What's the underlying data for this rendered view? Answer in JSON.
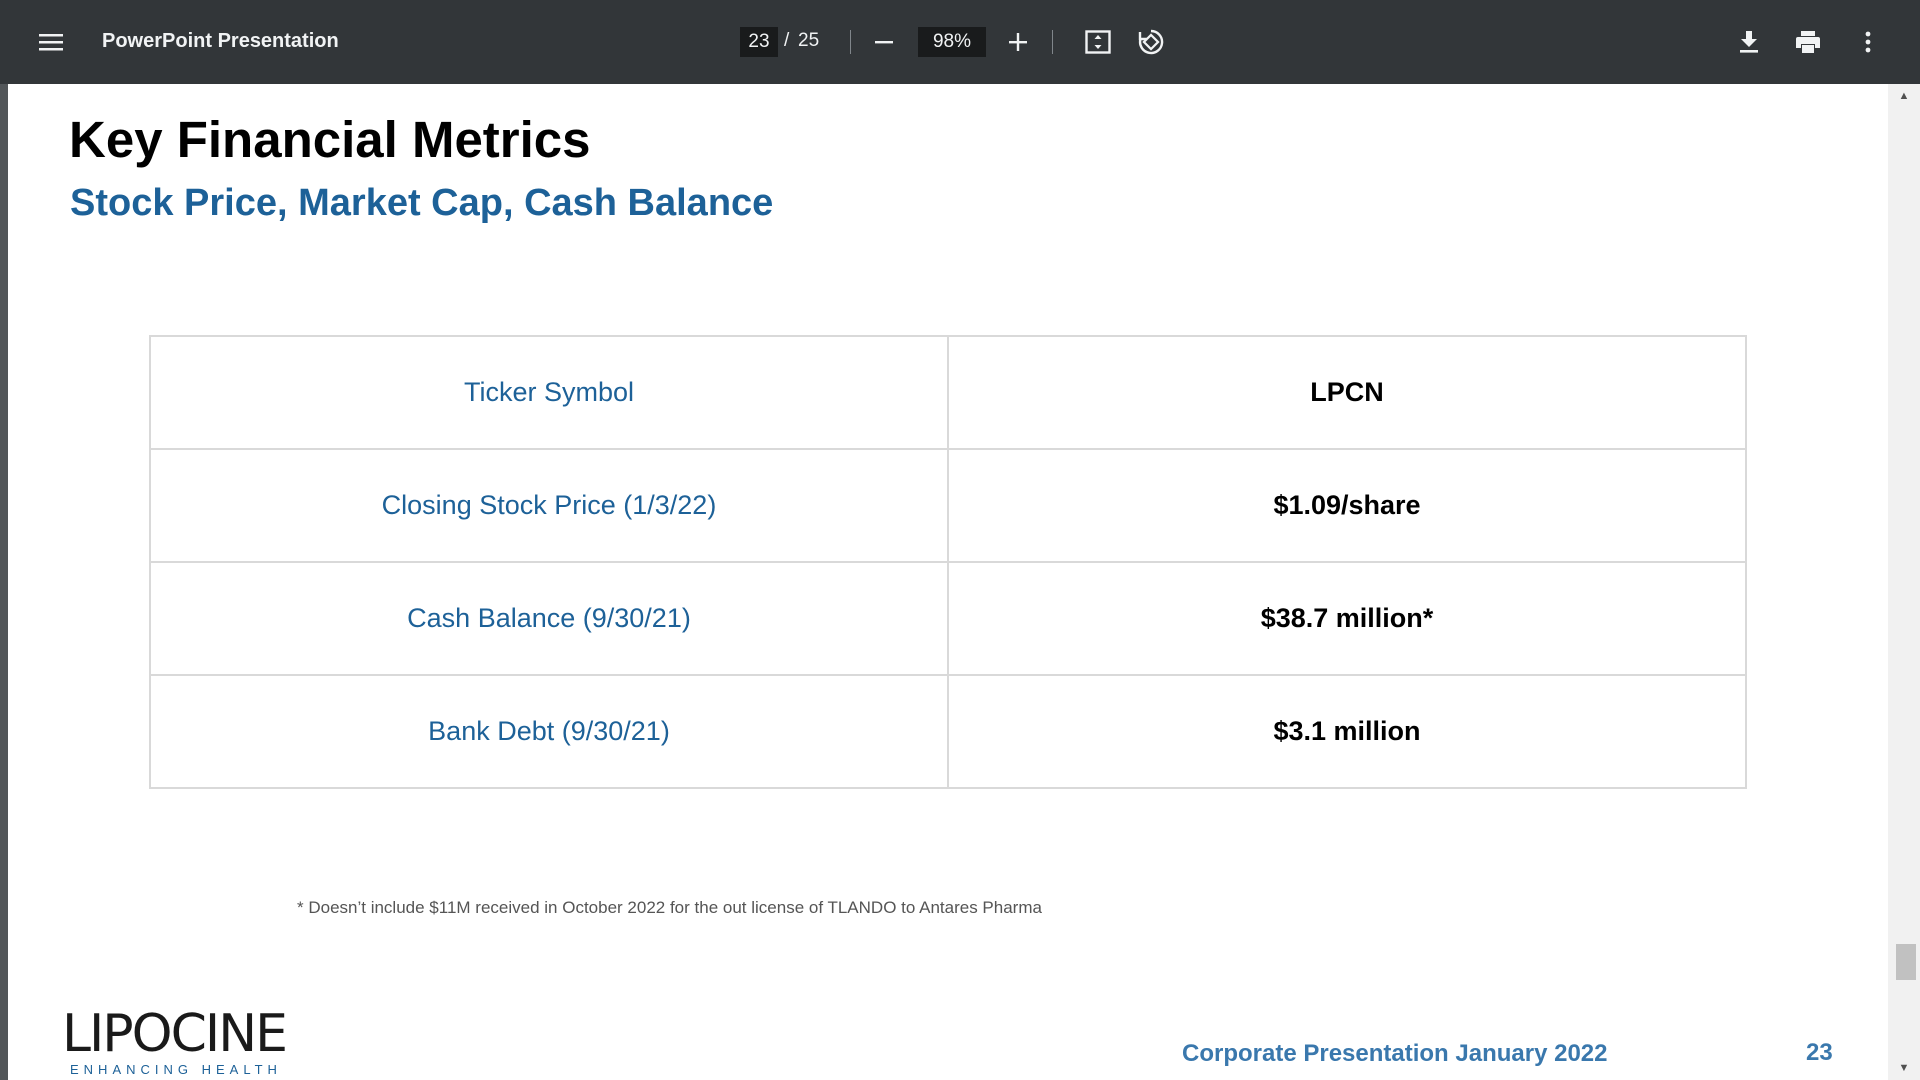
{
  "toolbar": {
    "title": "PowerPoint Presentation",
    "current_page": "23",
    "page_separator": "/",
    "total_pages": "25",
    "zoom": "98%",
    "icons": [
      "menu-icon",
      "minus-icon",
      "plus-icon",
      "fit-page-icon",
      "rotate-icon",
      "download-icon",
      "print-icon",
      "more-vert-icon"
    ]
  },
  "slide": {
    "title": "Key Financial Metrics",
    "subtitle": "Stock Price, Market Cap, Cash Balance",
    "rows": [
      {
        "label": "Ticker Symbol",
        "value": "LPCN"
      },
      {
        "label": "Closing Stock Price (1/3/22)",
        "value": "$1.09/share"
      },
      {
        "label": "Cash Balance (9/30/21)",
        "value": "$38.7 million*"
      },
      {
        "label": "Bank Debt (9/30/21)",
        "value": "$3.1 million"
      }
    ],
    "footnote": "* Doesn’t include $11M received in October 2022 for the out license of TLANDO to Antares Pharma",
    "logo_text": "LIPOCINE",
    "logo_tagline": "ENHANCING HEALTH",
    "footer": "Corporate Presentation January 2022",
    "page_number": "23"
  },
  "colors": {
    "toolbar_bg": "#323639",
    "accent_blue": "#1d6198",
    "footer_blue": "#3a78ad"
  }
}
